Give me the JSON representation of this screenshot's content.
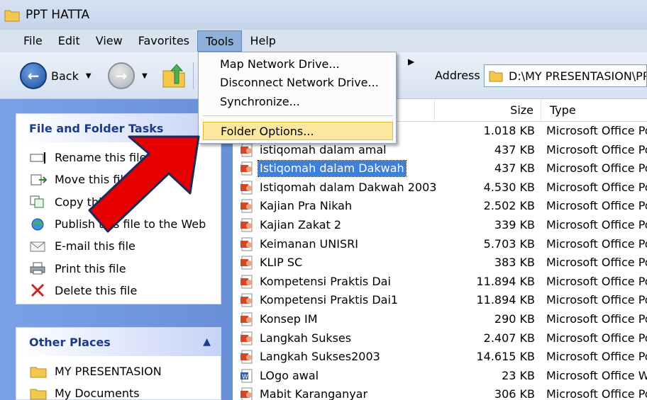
{
  "window": {
    "title": "PPT HATTA"
  },
  "menu": {
    "items": [
      "File",
      "Edit",
      "View",
      "Favorites",
      "Tools",
      "Help"
    ],
    "active": "Tools"
  },
  "toolbar": {
    "back_label": "Back",
    "address_label": "Address",
    "address_value": "D:\\MY PRESENTASION\\PP"
  },
  "tools_menu": {
    "items": [
      "Map Network Drive...",
      "Disconnect Network Drive...",
      "Synchronize...",
      "Folder Options..."
    ],
    "highlighted": "Folder Options..."
  },
  "left_pane": {
    "file_tasks": {
      "title": "File and Folder Tasks",
      "items": [
        {
          "label": "Rename this file",
          "icon": "rename-icon"
        },
        {
          "label": "Move this file",
          "icon": "move-icon"
        },
        {
          "label": "Copy this file",
          "icon": "copy-icon"
        },
        {
          "label": "Publish this file to the Web",
          "icon": "globe-icon"
        },
        {
          "label": "E-mail this file",
          "icon": "email-icon"
        },
        {
          "label": "Print this file",
          "icon": "printer-icon"
        },
        {
          "label": "Delete this file",
          "icon": "delete-icon"
        }
      ]
    },
    "other_places": {
      "title": "Other Places",
      "items": [
        {
          "label": "MY PRESENTASION",
          "icon": "folder-icon"
        },
        {
          "label": "My Documents",
          "icon": "folder-icon"
        }
      ]
    }
  },
  "file_list": {
    "columns": {
      "size": "Size",
      "type": "Type"
    },
    "rows": [
      {
        "name": "",
        "size": "1.018 KB",
        "type": "Microsoft Office Po",
        "icon": "powerpoint-icon"
      },
      {
        "name": "istiqomah dalam amal",
        "size": "437 KB",
        "type": "Microsoft Office Po",
        "icon": "powerpoint-icon"
      },
      {
        "name": "Istiqomah dalam Dakwah",
        "size": "437 KB",
        "type": "Microsoft Office Po",
        "icon": "powerpoint-icon",
        "selected": true
      },
      {
        "name": "Istiqomah dalam Dakwah 2003",
        "size": "4.530 KB",
        "type": "Microsoft Office Po",
        "icon": "powerpoint-icon"
      },
      {
        "name": "Kajian Pra Nikah",
        "size": "2.502 KB",
        "type": "Microsoft Office Po",
        "icon": "powerpoint-icon"
      },
      {
        "name": "Kajian Zakat 2",
        "size": "339 KB",
        "type": "Microsoft Office Po",
        "icon": "powerpoint-icon"
      },
      {
        "name": "Keimanan UNISRI",
        "size": "5.703 KB",
        "type": "Microsoft Office Po",
        "icon": "powerpoint-icon"
      },
      {
        "name": "KLIP SC",
        "size": "383 KB",
        "type": "Microsoft Office Po",
        "icon": "powerpoint-icon"
      },
      {
        "name": "Kompetensi Praktis Dai",
        "size": "11.894 KB",
        "type": "Microsoft Office Po",
        "icon": "powerpoint-icon"
      },
      {
        "name": "Kompetensi Praktis Dai1",
        "size": "11.894 KB",
        "type": "Microsoft Office Po",
        "icon": "powerpoint-icon"
      },
      {
        "name": "Konsep IM",
        "size": "290 KB",
        "type": "Microsoft Office Po",
        "icon": "powerpoint-icon"
      },
      {
        "name": "Langkah Sukses",
        "size": "2.407 KB",
        "type": "Microsoft Office Po",
        "icon": "powerpoint-icon"
      },
      {
        "name": "Langkah Sukses2003",
        "size": "14.615 KB",
        "type": "Microsoft Office Po",
        "icon": "powerpoint-icon"
      },
      {
        "name": "LOgo awal",
        "size": "23 KB",
        "type": "Microsoft Office W",
        "icon": "word-icon"
      },
      {
        "name": "Mabit Karanganyar",
        "size": "306 KB",
        "type": "Microsoft Office Po",
        "icon": "powerpoint-icon"
      }
    ]
  },
  "colors": {
    "accent_red": "#e60000",
    "selection": "#3d7fd9",
    "menu_highlight": "#fbe89e"
  }
}
